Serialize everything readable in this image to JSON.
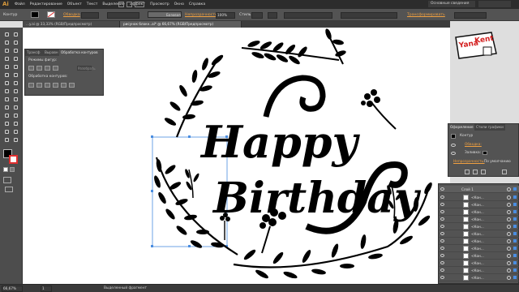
{
  "app": {
    "logo": "Ai",
    "menus": [
      "Файл",
      "Редактирование",
      "Объект",
      "Текст",
      "Выделение",
      "Эффект",
      "Просмотр",
      "Окно",
      "Справка"
    ],
    "workspace": "Основные сведения"
  },
  "control_bar": {
    "context": "Контур",
    "stroke_label": "Обводка",
    "style_label": "Базовая",
    "opacity_label": "Непрозрачность",
    "opacity_value": "100%",
    "style2_label": "Стиль",
    "transform_label": "Трансформировать"
  },
  "tabs": [
    {
      "label": "...y.ai @ 33,33% (RGB/Предпросмотр)",
      "active": false
    },
    {
      "label": "рисунок блокн..ai* @ 66,67% (RGB/Предпросмотр)",
      "active": true
    }
  ],
  "pathfinder": {
    "tabs": [
      "Трансф",
      "Выравн",
      "Обработка контуров"
    ],
    "shape_modes_label": "Режимы фигур:",
    "expand_label": "Разобрать",
    "pathfinders_label": "Обработка контуров:"
  },
  "appearance": {
    "tabs": [
      "Оформление",
      "Стили графики"
    ],
    "object_label": "Контур",
    "stroke_label": "Обводка:",
    "fill_label": "Заливка:",
    "opacity_label": "Непрозрачность:",
    "opacity_value": "По умолчанию"
  },
  "layers": {
    "top_layer": "Слой 1",
    "items": [
      "<Кон...",
      "<Кон...",
      "<Кон...",
      "<Кон...",
      "<Кон...",
      "<Кон...",
      "<Кон...",
      "<Кон...",
      "<Кон...",
      "<Кон...",
      "<Кон...",
      "<Кон..."
    ]
  },
  "status": {
    "zoom": "66,67%",
    "page": "1",
    "selection_text": "Выделенный фрагмент"
  },
  "artwork": {
    "line1": "Happy",
    "line2": "Birthday"
  },
  "brand_logo": {
    "line1": "Yana",
    "line2": "Kent"
  },
  "colors": {
    "accent": "#f0a040",
    "panel": "#535353",
    "selection": "#4a8de0"
  }
}
